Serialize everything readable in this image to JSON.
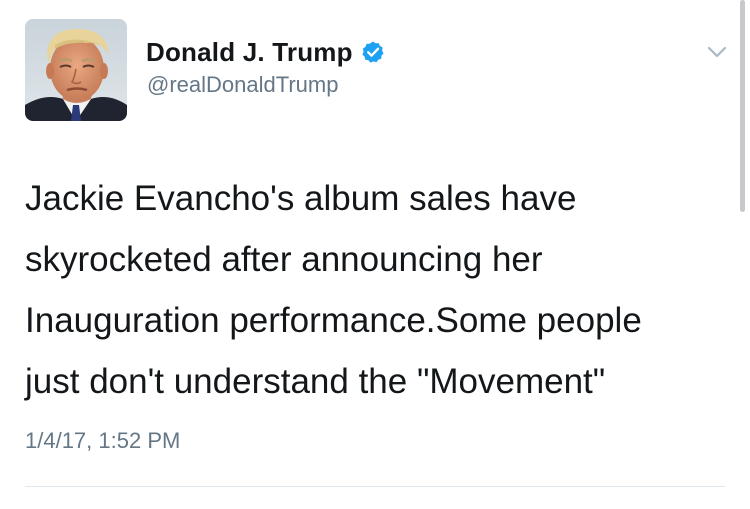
{
  "user": {
    "display_name": "Donald J. Trump",
    "handle": "@realDonaldTrump",
    "verified": true,
    "avatar_icon": "profile-photo"
  },
  "tweet": {
    "lines": [
      "Jackie Evancho's album sales have",
      "skyrocketed after announcing her",
      "Inauguration performance.Some people",
      "just don't understand the \"Movement\""
    ],
    "timestamp": "1/4/17, 1:52 PM"
  },
  "icons": {
    "verified": "verified-badge-icon",
    "menu": "chevron-down-icon"
  },
  "colors": {
    "text": "#14171a",
    "secondary": "#657786",
    "verified_blue": "#1da1f2",
    "divider": "#e1e8ed"
  }
}
